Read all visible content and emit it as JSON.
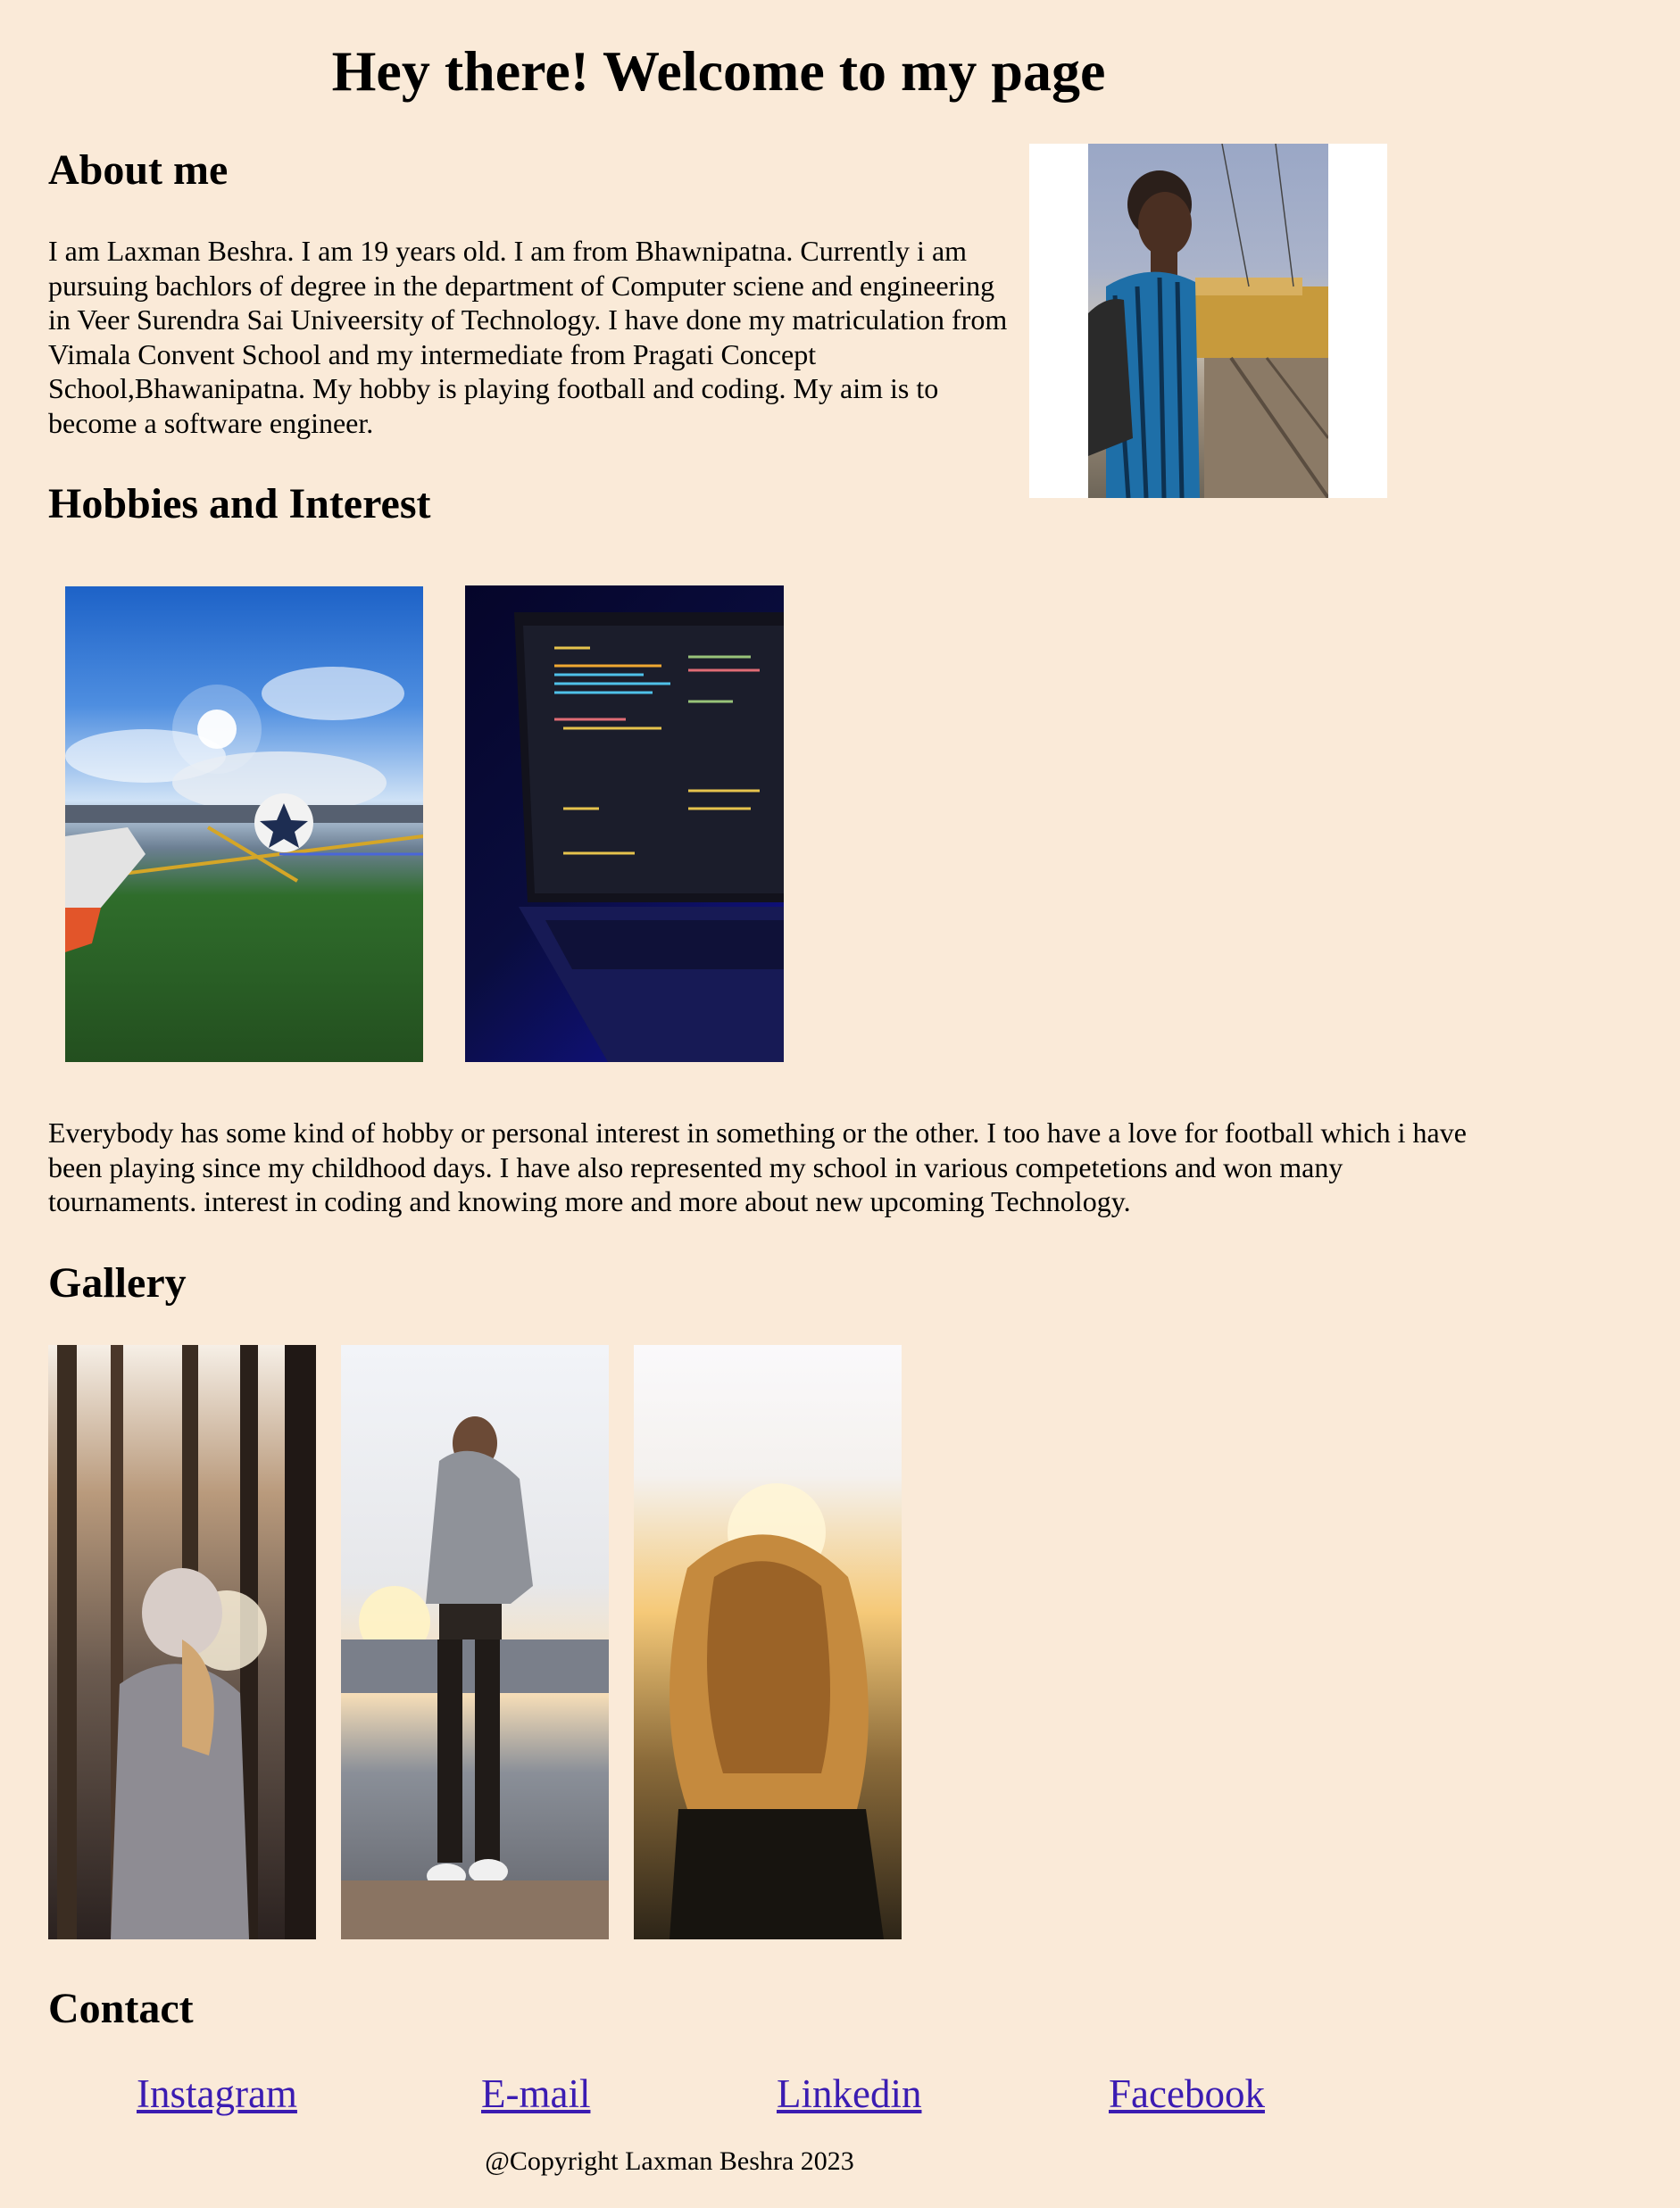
{
  "page": {
    "title": "Hey there! Welcome to my page"
  },
  "about": {
    "heading": "About me",
    "text": "I am Laxman Beshra. I am 19 years old. I am from Bhawnipatna. Currently i am pursuing bachlors of degree in the department of Computer sciene and engineering in Veer Surendra Sai Univeersity of Technology. I have done my matriculation from Vimala Convent School and my intermediate from Pragati Concept School,Bhawanipatna. My hobby is playing football and coding. My aim is to become a software engineer.",
    "photo_icon": "profile-photo"
  },
  "hobbies": {
    "heading": "Hobbies and Interest",
    "text": "Everybody has some kind of hobby or personal interest in something or the other. I too have a love for football which i have been playing since my childhood days. I have also represented my school in various competetions and won many tournaments. interest in coding and knowing more and more about new upcoming Technology."
  },
  "gallery": {
    "heading": "Gallery"
  },
  "contact": {
    "heading": "Contact",
    "links": [
      "Instagram",
      "E-mail",
      "Linkedin",
      "Facebook"
    ],
    "link_color": "#3b1cb2"
  },
  "footer": {
    "copyright": "@Copyright Laxman Beshra 2023"
  },
  "colors": {
    "background": "#faead8"
  }
}
